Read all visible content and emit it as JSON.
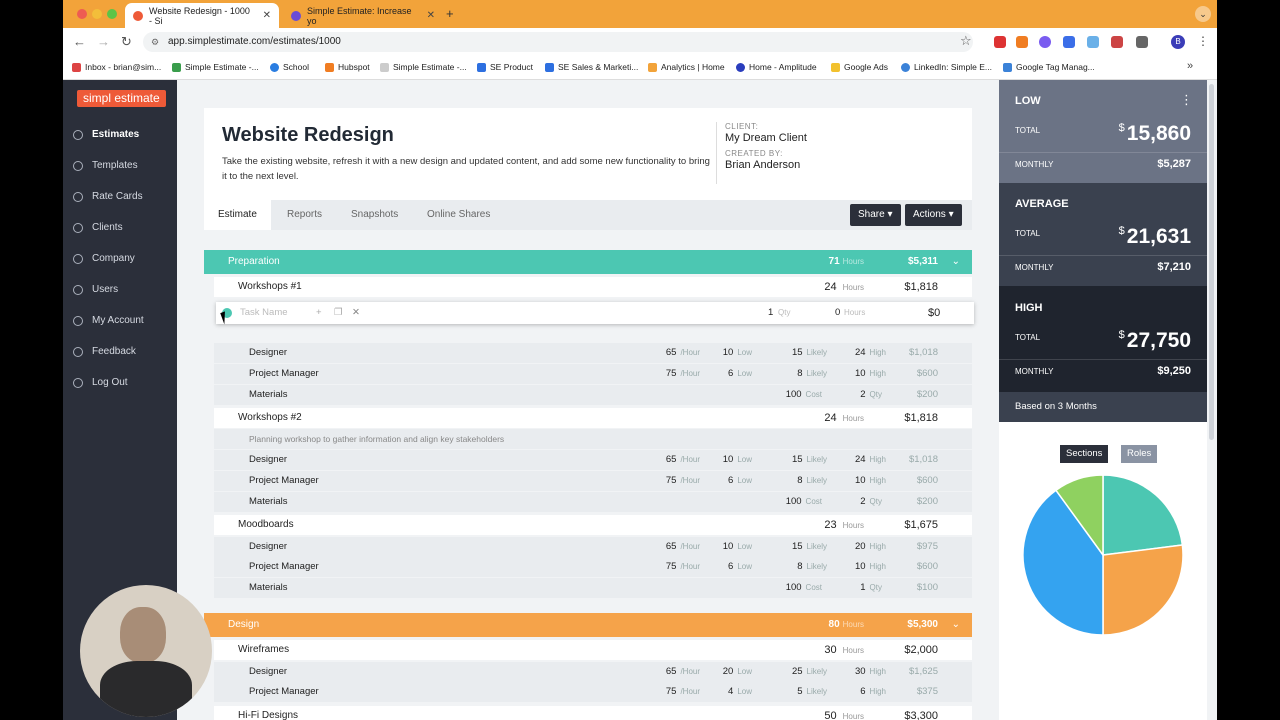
{
  "browser": {
    "tabs": [
      {
        "title": "Website Redesign - 1000 - Si",
        "active": true
      },
      {
        "title": "Simple Estimate: Increase yo",
        "active": false
      }
    ],
    "url": "app.simplestimate.com/estimates/1000",
    "profile": "B",
    "bookmarks": [
      "Inbox - brian@sim...",
      "Simple Estimate -...",
      "School",
      "Hubspot",
      "Simple Estimate -...",
      "SE Product",
      "SE Sales & Marketi...",
      "Analytics | Home",
      "Home - Amplitude",
      "Google Ads",
      "LinkedIn: Simple E...",
      "Google Tag Manag..."
    ]
  },
  "sidebar": {
    "logo": "simpl estimate",
    "items": [
      "Estimates",
      "Templates",
      "Rate Cards",
      "Clients",
      "Company",
      "Users",
      "My Account",
      "Feedback",
      "Log Out"
    ]
  },
  "estimate": {
    "title": "Website Redesign",
    "description": "Take the existing website, refresh it with a new design and updated content, and add some new functionality to bring it to the next level.",
    "client_label": "CLIENT:",
    "client": "My Dream Client",
    "created_label": "CREATED BY:",
    "created_by": "Brian Anderson",
    "tabs": [
      "Estimate",
      "Reports",
      "Snapshots",
      "Online Shares"
    ],
    "share_label": "Share",
    "actions_label": "Actions"
  },
  "units": {
    "hours": "Hours",
    "hour": "/Hour",
    "low": "Low",
    "likely": "Likely",
    "high": "High",
    "cost": "Cost",
    "qty": "Qty"
  },
  "new_task": {
    "placeholder": "Task Name",
    "qty": "1",
    "qty_label": "Qty",
    "hours": "0",
    "hours_label": "Hours",
    "amount": "$0"
  },
  "sections": [
    {
      "name": "Preparation",
      "hours": "71",
      "amount": "$5,311",
      "color": "#4cc7b2",
      "tasks": [
        {
          "name": "Workshops #1",
          "hours": "24",
          "amount": "$1,818",
          "rows": [
            {
              "name": "Designer",
              "rate": "65",
              "low": "10",
              "likely": "15",
              "high": "24",
              "total": "$1,018"
            },
            {
              "name": "Project Manager",
              "rate": "75",
              "low": "6",
              "likely": "8",
              "high": "10",
              "total": "$600"
            },
            {
              "name": "Materials",
              "cost": "100",
              "qty": "2",
              "total": "$200"
            }
          ]
        },
        {
          "name": "Workshops #2",
          "hours": "24",
          "amount": "$1,818",
          "notes": "Planning workshop to gather information and align key stakeholders",
          "rows": [
            {
              "name": "Designer",
              "rate": "65",
              "low": "10",
              "likely": "15",
              "high": "24",
              "total": "$1,018"
            },
            {
              "name": "Project Manager",
              "rate": "75",
              "low": "6",
              "likely": "8",
              "high": "10",
              "total": "$600"
            },
            {
              "name": "Materials",
              "cost": "100",
              "qty": "2",
              "total": "$200"
            }
          ]
        },
        {
          "name": "Moodboards",
          "hours": "23",
          "amount": "$1,675",
          "rows": [
            {
              "name": "Designer",
              "rate": "65",
              "low": "10",
              "likely": "15",
              "high": "20",
              "total": "$975"
            },
            {
              "name": "Project Manager",
              "rate": "75",
              "low": "6",
              "likely": "8",
              "high": "10",
              "total": "$600"
            },
            {
              "name": "Materials",
              "cost": "100",
              "qty": "1",
              "total": "$100"
            }
          ]
        }
      ]
    },
    {
      "name": "Design",
      "hours": "80",
      "amount": "$5,300",
      "color": "#f5a34a",
      "tasks": [
        {
          "name": "Wireframes",
          "hours": "30",
          "amount": "$2,000",
          "rows": [
            {
              "name": "Designer",
              "rate": "65",
              "low": "20",
              "likely": "25",
              "high": "30",
              "total": "$1,625"
            },
            {
              "name": "Project Manager",
              "rate": "75",
              "low": "4",
              "likely": "5",
              "high": "6",
              "total": "$375"
            }
          ]
        },
        {
          "name": "Hi-Fi Designs",
          "hours": "50",
          "amount": "$3,300",
          "rows": []
        }
      ]
    }
  ],
  "summary": {
    "low": {
      "label": "LOW",
      "total_label": "TOTAL",
      "total": "15,860",
      "monthly_label": "MONTHLY",
      "monthly": "$5,287"
    },
    "average": {
      "label": "AVERAGE",
      "total_label": "TOTAL",
      "total": "21,631",
      "monthly_label": "MONTHLY",
      "monthly": "$7,210"
    },
    "high": {
      "label": "HIGH",
      "total_label": "TOTAL",
      "total": "27,750",
      "monthly_label": "MONTHLY",
      "monthly": "$9,250"
    },
    "currency": "$",
    "based_on": "Based on 3 Months",
    "toggle": [
      "Sections",
      "Roles"
    ]
  },
  "chart_data": {
    "type": "pie",
    "values": [
      23,
      27,
      40,
      10
    ],
    "colors": [
      "#4cc7b2",
      "#f5a34a",
      "#34a3f0",
      "#8fd160"
    ]
  }
}
